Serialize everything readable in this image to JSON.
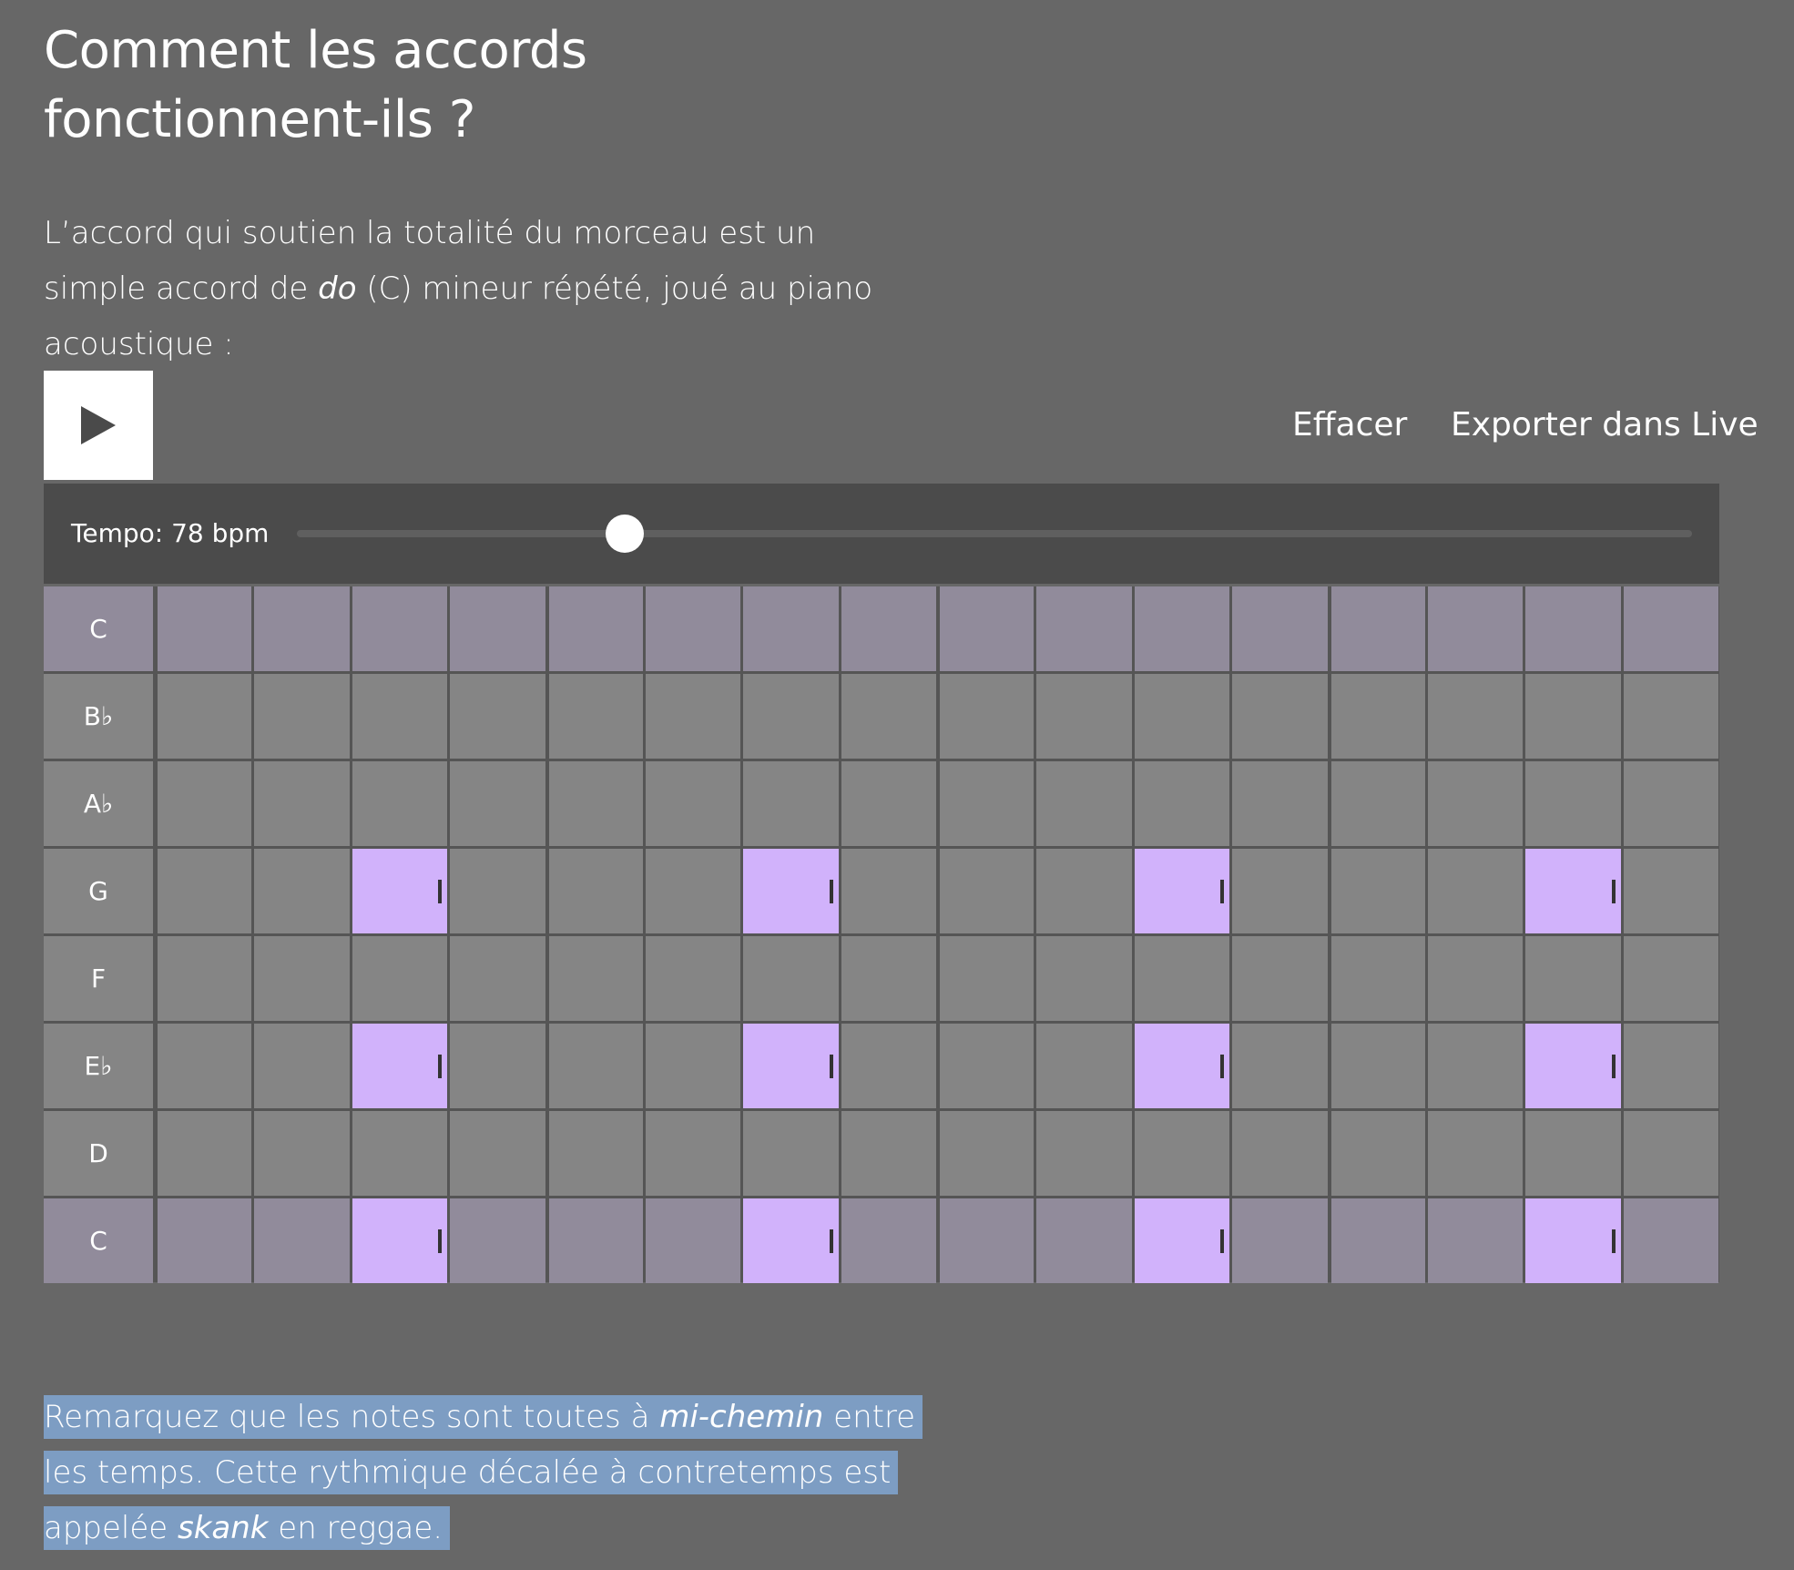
{
  "heading": "Comment les accords fonctionnent-ils ?",
  "intro": {
    "before": "L’accord qui soutien la totalité du morceau est un simple accord de ",
    "italic": "do",
    "after": " (C) mineur répété, joué au piano acoustique :"
  },
  "controls": {
    "play_icon": "play-icon",
    "clear_label": "Effacer",
    "export_label": "Exporter dans Live"
  },
  "tempo": {
    "label": "Tempo: 78 bpm",
    "bpm": 78,
    "slider_fraction": 0.235
  },
  "sequencer": {
    "steps": 16,
    "steps_per_beat": 4,
    "rows": [
      {
        "label": "C",
        "tonic": true,
        "active": []
      },
      {
        "label": "B♭",
        "tonic": false,
        "active": []
      },
      {
        "label": "A♭",
        "tonic": false,
        "active": []
      },
      {
        "label": "G",
        "tonic": false,
        "active": [
          2,
          6,
          10,
          14
        ]
      },
      {
        "label": "F",
        "tonic": false,
        "active": []
      },
      {
        "label": "E♭",
        "tonic": false,
        "active": [
          2,
          6,
          10,
          14
        ]
      },
      {
        "label": "D",
        "tonic": false,
        "active": []
      },
      {
        "label": "C",
        "tonic": true,
        "active": [
          2,
          6,
          10,
          14
        ]
      }
    ]
  },
  "note": {
    "part1": "Remarquez que les notes sont toutes à ",
    "italic1": "mi-chemin",
    "part2": " entre les temps. Cette rythmique décalée à contretemps est appelée ",
    "italic2": "skank",
    "part3": " en reggae."
  },
  "colors": {
    "background": "#676767",
    "cell": "#858585",
    "tonic_cell": "#918b9b",
    "active_cell": "#d1b2fb",
    "tempo_bar": "#4b4b4b",
    "selection": "#7d9dc3"
  }
}
